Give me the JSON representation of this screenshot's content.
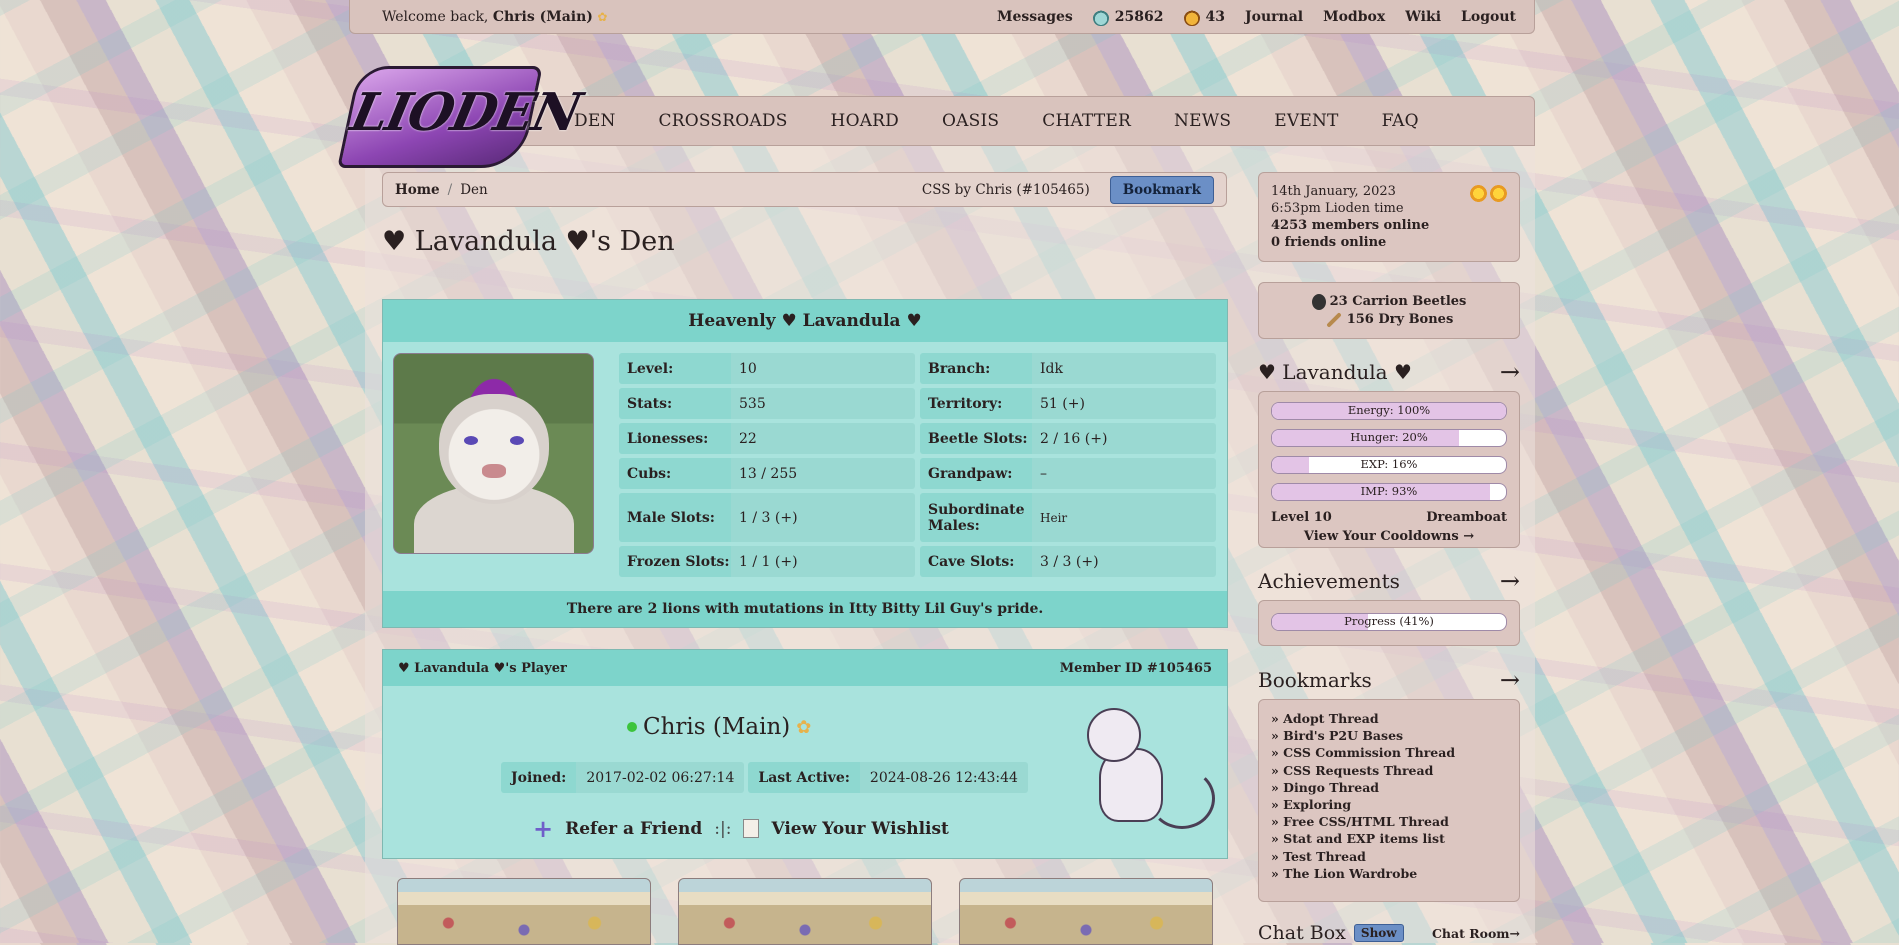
{
  "topbar": {
    "welcome_prefix": "Welcome back, ",
    "user": "Chris (Main)",
    "messages": "Messages",
    "blue_beetles": "25862",
    "gold_beetles": "43",
    "journal": "Journal",
    "modbox": "Modbox",
    "wiki": "Wiki",
    "logout": "Logout"
  },
  "logo": "LIODEN",
  "nav": [
    "DEN",
    "CROSSROADS",
    "HOARD",
    "OASIS",
    "CHATTER",
    "NEWS",
    "EVENT",
    "FAQ"
  ],
  "breadcrumb": {
    "home": "Home",
    "sep": "/",
    "current": "Den",
    "css_credit": "CSS by Chris (#105465)",
    "bookmark": "Bookmark"
  },
  "page_title": "♥ Lavandula ♥'s Den",
  "lion": {
    "name": "Heavenly ♥ Lavandula ♥",
    "stats": [
      [
        {
          "k": "Level:",
          "v": "10"
        },
        {
          "k": "Branch:",
          "v": "Idk"
        }
      ],
      [
        {
          "k": "Stats:",
          "v": "535"
        },
        {
          "k": "Territory:",
          "v": "51 (+)"
        }
      ],
      [
        {
          "k": "Lionesses:",
          "v": "22"
        },
        {
          "k": "Beetle Slots:",
          "v": "2 / 16 (+)"
        }
      ],
      [
        {
          "k": "Cubs:",
          "v": "13 / 255"
        },
        {
          "k": "Grandpaw:",
          "v": "–"
        }
      ],
      [
        {
          "k": "Male Slots:",
          "v": "1 / 3 (+)"
        },
        {
          "k": "Subordinate Males:",
          "v": "Heir"
        }
      ],
      [
        {
          "k": "Frozen Slots:",
          "v": "1 / 1 (+)"
        },
        {
          "k": "Cave Slots:",
          "v": "3 / 3 (+)"
        }
      ]
    ],
    "mutation_note": "There are 2 lions with mutations in Itty Bitty Lil Guy's pride."
  },
  "player": {
    "header_left": "♥ Lavandula ♥'s Player",
    "member_id": "Member ID #105465",
    "name": "Chris (Main)",
    "joined_label": "Joined:",
    "joined": "2017-02-02 06:27:14",
    "active_label": "Last Active:",
    "active": "2024-08-26 12:43:44",
    "refer": "Refer a Friend",
    "sep": ":|:",
    "wishlist": "View Your Wishlist"
  },
  "sidebar": {
    "date": "14th January, 2023",
    "time": "6:53pm Lioden time",
    "members_online": "4253 members online",
    "friends_online": "0 friends online",
    "carrion": "23 Carrion Beetles",
    "bones": "156 Dry Bones",
    "lion_heading": "♥ Lavandula ♥",
    "arrow": "→",
    "bars": [
      {
        "label": "Energy: 100%",
        "value": 1.0
      },
      {
        "label": "Hunger: 20%",
        "value": 0.8
      },
      {
        "label": "EXP: 16%",
        "value": 0.16
      },
      {
        "label": "IMP: 93%",
        "value": 0.93
      }
    ],
    "level": "Level 10",
    "status": "Dreamboat",
    "cooldowns": "View Your Cooldowns →",
    "achievements_heading": "Achievements",
    "achievements_progress": "Progress (41%)",
    "achievements_value": 0.41,
    "bookmarks_heading": "Bookmarks",
    "bookmarks": [
      "» Adopt Thread",
      "» Bird's P2U Bases",
      "» CSS Commission Thread",
      "» CSS Requests Thread",
      "» Dingo Thread",
      "» Exploring",
      "» Free CSS/HTML Thread",
      "» Stat and EXP items list",
      "» Test Thread",
      "» The Lion Wardrobe"
    ],
    "chat_box": "Chat Box",
    "show": "Show",
    "chat_room": "Chat Room→"
  },
  "colors": {
    "teal_header": "#7dd4cb",
    "teal_body": "#a9e3dd",
    "panel": "#d9c3bd",
    "button": "#6b8fc6"
  }
}
